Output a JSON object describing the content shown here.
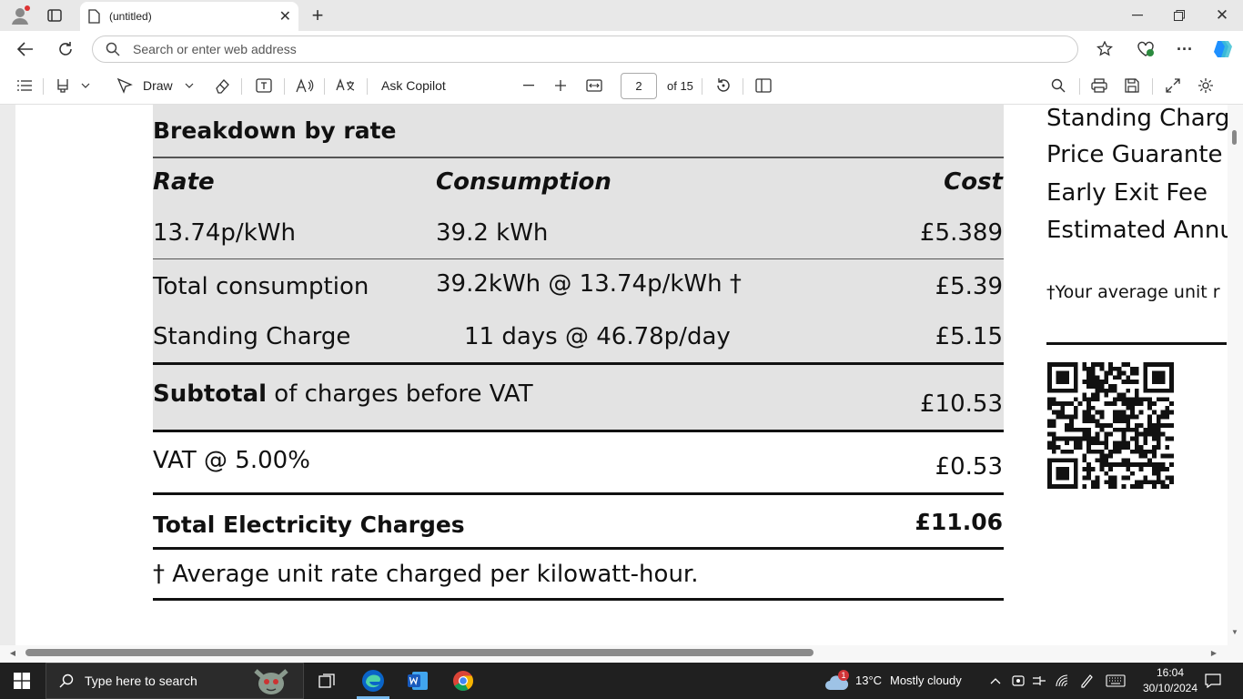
{
  "browser": {
    "tab_title": "(untitled)",
    "address_placeholder": "Search or enter web address"
  },
  "pdf_toolbar": {
    "draw_label": "Draw",
    "ask_copilot_label": "Ask Copilot",
    "page_number": "2",
    "page_total": "of 15"
  },
  "document": {
    "section_title": "Breakdown by rate",
    "table_headers": {
      "rate": "Rate",
      "consumption": "Consumption",
      "cost": "Cost"
    },
    "rate_row": {
      "rate": "13.74p/kWh",
      "consumption": "39.2 kWh",
      "cost": "£5.389"
    },
    "total_consumption": {
      "label": "Total consumption",
      "detail": "39.2kWh @ 13.74p/kWh †",
      "cost": "£5.39"
    },
    "standing_charge": {
      "label": "Standing Charge",
      "detail": "11 days @ 46.78p/day",
      "cost": "£5.15"
    },
    "subtotal": {
      "bold": "Subtotal",
      "rest": " of charges before VAT",
      "cost": "£10.53"
    },
    "vat": {
      "label": "VAT @ 5.00%",
      "cost": "£0.53"
    },
    "total": {
      "label": "Total Electricity Charges",
      "cost": "£11.06"
    },
    "footnote": "† Average unit rate charged per kilowatt-hour.",
    "right_column": [
      "Standing Charg",
      "Price Guarante",
      "Early Exit Fee",
      "Estimated Annu"
    ],
    "right_footnote": "†Your average unit r"
  },
  "taskbar": {
    "search_placeholder": "Type here to search",
    "weather_temp": "13°C",
    "weather_desc": "Mostly cloudy",
    "weather_badge": "1",
    "time": "16:04",
    "date": "30/10/2024"
  },
  "colors": {
    "edge_blue": "#0a64c8",
    "taskbar": "#202020",
    "table_grey": "#e3e3e3"
  }
}
